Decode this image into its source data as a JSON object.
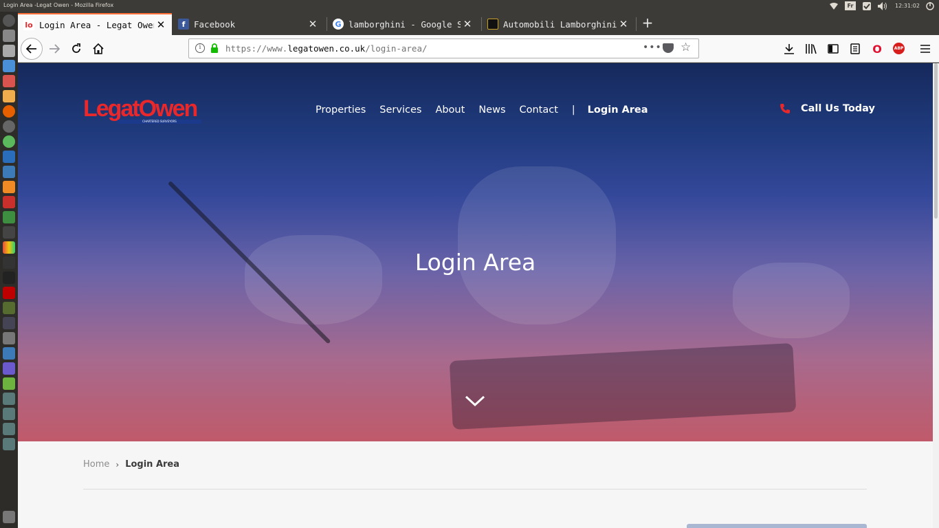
{
  "os": {
    "window_title": "Login Area -Legat Owen - Mozilla Firefox",
    "keyboard_layout": "Fr",
    "clock": "12:31:02"
  },
  "browser": {
    "tabs": [
      {
        "label": "Login Area - Legat Owen",
        "active": true,
        "favicon": "legatowen-favicon",
        "favicon_text": "lo"
      },
      {
        "label": "Facebook",
        "active": false,
        "favicon": "facebook-favicon",
        "favicon_text": "f"
      },
      {
        "label": "lamborghini - Google Sea",
        "active": false,
        "favicon": "google-favicon",
        "favicon_text": "G"
      },
      {
        "label": "Automobili Lamborghini",
        "active": false,
        "favicon": "lamborghini-favicon",
        "favicon_text": ""
      }
    ],
    "url": {
      "scheme": "https://www.",
      "host": "legatowen.co.uk",
      "path": "/login-area/"
    },
    "page_actions": "•••",
    "toolbar_icons": [
      "download-icon",
      "library-icon",
      "sidebar-icon",
      "reader-icon",
      "opera-icon",
      "adblock-icon",
      "menu-icon"
    ],
    "abp_label": "ABP",
    "opera_label": "O"
  },
  "site": {
    "logo_text": "LegatOwen",
    "logo_tagline": "CHARTERED SURVEYORS",
    "nav": [
      "Properties",
      "Services",
      "About",
      "News",
      "Contact"
    ],
    "nav_divider": "|",
    "nav_current": "Login Area",
    "call_us": "Call Us Today",
    "hero_title": "Login Area",
    "breadcrumb": {
      "home": "Home",
      "separator": "›",
      "current": "Login Area"
    }
  },
  "colors": {
    "brand_red": "#e8282b",
    "brand_blue": "#1b3a8c",
    "hero_top": "#16295c",
    "hero_bottom": "#c05a6a"
  }
}
